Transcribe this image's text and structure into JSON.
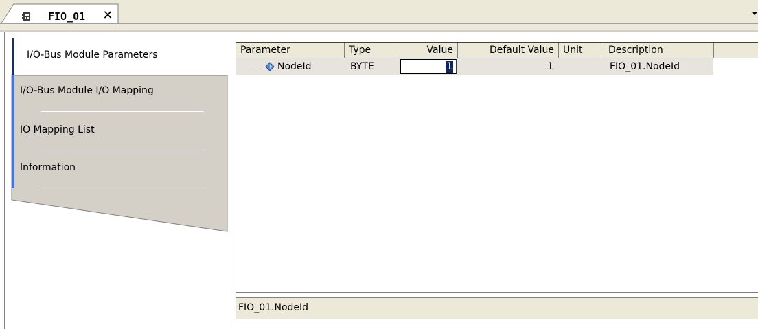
{
  "editor_tab": {
    "title": "FIO_01",
    "close": "✕",
    "icon": "device-icon"
  },
  "side_tabs": [
    {
      "label": "I/O-Bus Module Parameters",
      "active": true
    },
    {
      "label": "I/O-Bus Module I/O Mapping",
      "active": false
    },
    {
      "label": "IO Mapping List",
      "active": false
    },
    {
      "label": "Information",
      "active": false
    }
  ],
  "table": {
    "columns": [
      "Parameter",
      "Type",
      "Value",
      "Default Value",
      "Unit",
      "Description"
    ],
    "rows": [
      {
        "parameter": "NodeId",
        "type": "BYTE",
        "value": "1",
        "default_value": "1",
        "unit": "",
        "description": "FIO_01.NodeId"
      }
    ]
  },
  "status_bar": {
    "text": "FIO_01.NodeId"
  },
  "colors": {
    "active_tab_bar": "#1c2d5a",
    "inactive_tab_bar": "#4a72d8",
    "selection": "#0a246a",
    "chrome": "#ece9d8",
    "tab_panel_gray": "#d4d0c8"
  }
}
